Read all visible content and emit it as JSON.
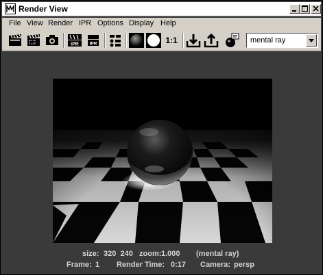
{
  "window": {
    "title": "Render View"
  },
  "menubar": {
    "items": [
      "File",
      "View",
      "Render",
      "IPR",
      "Options",
      "Display",
      "Help"
    ]
  },
  "toolbar": {
    "buttons": [
      {
        "icon": "clapper-redo-icon"
      },
      {
        "icon": "clapper-region-icon"
      },
      {
        "icon": "camera-snapshot-icon"
      },
      {
        "icon": "ipr-render-icon",
        "label": "IPR"
      },
      {
        "icon": "ipr-refresh-icon",
        "label": "IPR"
      },
      {
        "icon": "render-settings-icon"
      },
      {
        "icon": "display-rgb-icon"
      },
      {
        "icon": "display-alpha-icon"
      },
      {
        "icon": "display-real-size-icon",
        "label": "1:1"
      },
      {
        "icon": "keep-image-icon"
      },
      {
        "icon": "remove-image-icon"
      },
      {
        "icon": "render-log-icon"
      }
    ],
    "renderer_value": "mental ray"
  },
  "status": {
    "size_label": "size:",
    "size_value": "320  240",
    "zoom_label": "zoom:",
    "zoom_value": "1.000",
    "renderer_paren": "(mental ray)",
    "frame_label": "Frame:",
    "frame_value": "1",
    "render_time_label": "Render Time:",
    "render_time_value": "0:17",
    "camera_label": "Camera:",
    "camera_value": "persp"
  },
  "colors": {
    "panel_bg": "#3a3a3a",
    "chrome_bg": "#d4d0c8",
    "status_text": "#d4d4d4"
  }
}
